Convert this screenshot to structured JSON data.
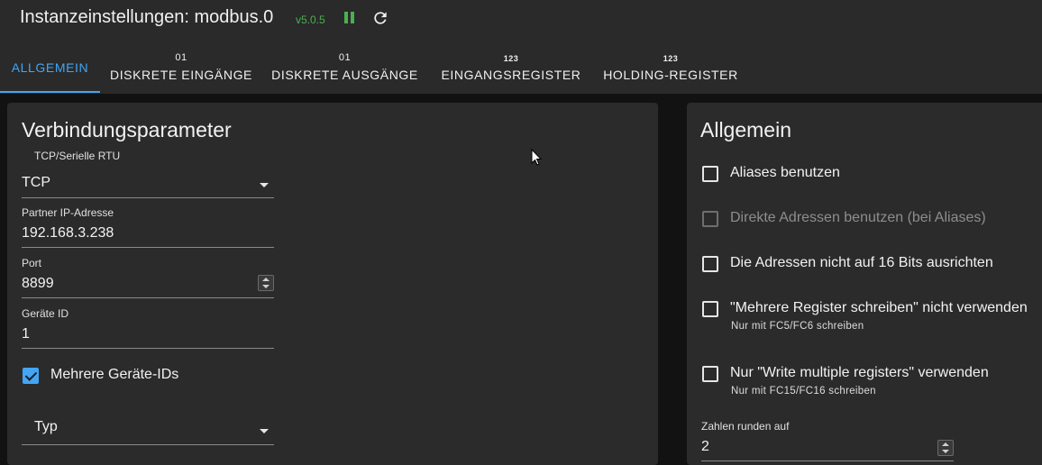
{
  "header": {
    "title": "Instanzeinstellungen: modbus.0",
    "version": "v5.0.5",
    "icons": {
      "pause": "pause-icon",
      "refresh": "refresh-icon"
    },
    "colors": {
      "status": "#4caf50",
      "accent": "#42a5f5"
    }
  },
  "tabs": [
    {
      "icon": "",
      "label": "ALLGEMEIN",
      "active": true
    },
    {
      "icon": "01",
      "label": "DISKRETE EINGÄNGE",
      "active": false
    },
    {
      "icon": "01",
      "label": "DISKRETE AUSGÄNGE",
      "active": false
    },
    {
      "icon": "123",
      "label": "EINGANGSREGISTER",
      "active": false
    },
    {
      "icon": "123",
      "label": "HOLDING-REGISTER",
      "active": false
    }
  ],
  "connection": {
    "title": "Verbindungsparameter",
    "type_label": "TCP/Serielle RTU",
    "type_value": "TCP",
    "ip_label": "Partner IP-Adresse",
    "ip_value": "192.168.3.238",
    "port_label": "Port",
    "port_value": "8899",
    "device_label": "Geräte ID",
    "device_value": "1",
    "multi_ids_label": "Mehrere Geräte-IDs",
    "multi_ids_checked": true,
    "typ_label": "Typ"
  },
  "general": {
    "title": "Allgemein",
    "options": [
      {
        "label": "Aliases benutzen",
        "checked": false,
        "disabled": false,
        "help": ""
      },
      {
        "label": "Direkte Adressen benutzen (bei Aliases)",
        "checked": false,
        "disabled": true,
        "help": ""
      },
      {
        "label": "Die Adressen nicht auf 16 Bits ausrichten",
        "checked": false,
        "disabled": false,
        "help": ""
      },
      {
        "label": "\"Mehrere Register schreiben\" nicht verwenden",
        "checked": false,
        "disabled": false,
        "help": "Nur mit FC5/FC6 schreiben"
      },
      {
        "label": "Nur \"Write multiple registers\" verwenden",
        "checked": false,
        "disabled": false,
        "help": "Nur mit FC15/FC16 schreiben"
      }
    ],
    "round_label": "Zahlen runden auf",
    "round_value": "2"
  }
}
